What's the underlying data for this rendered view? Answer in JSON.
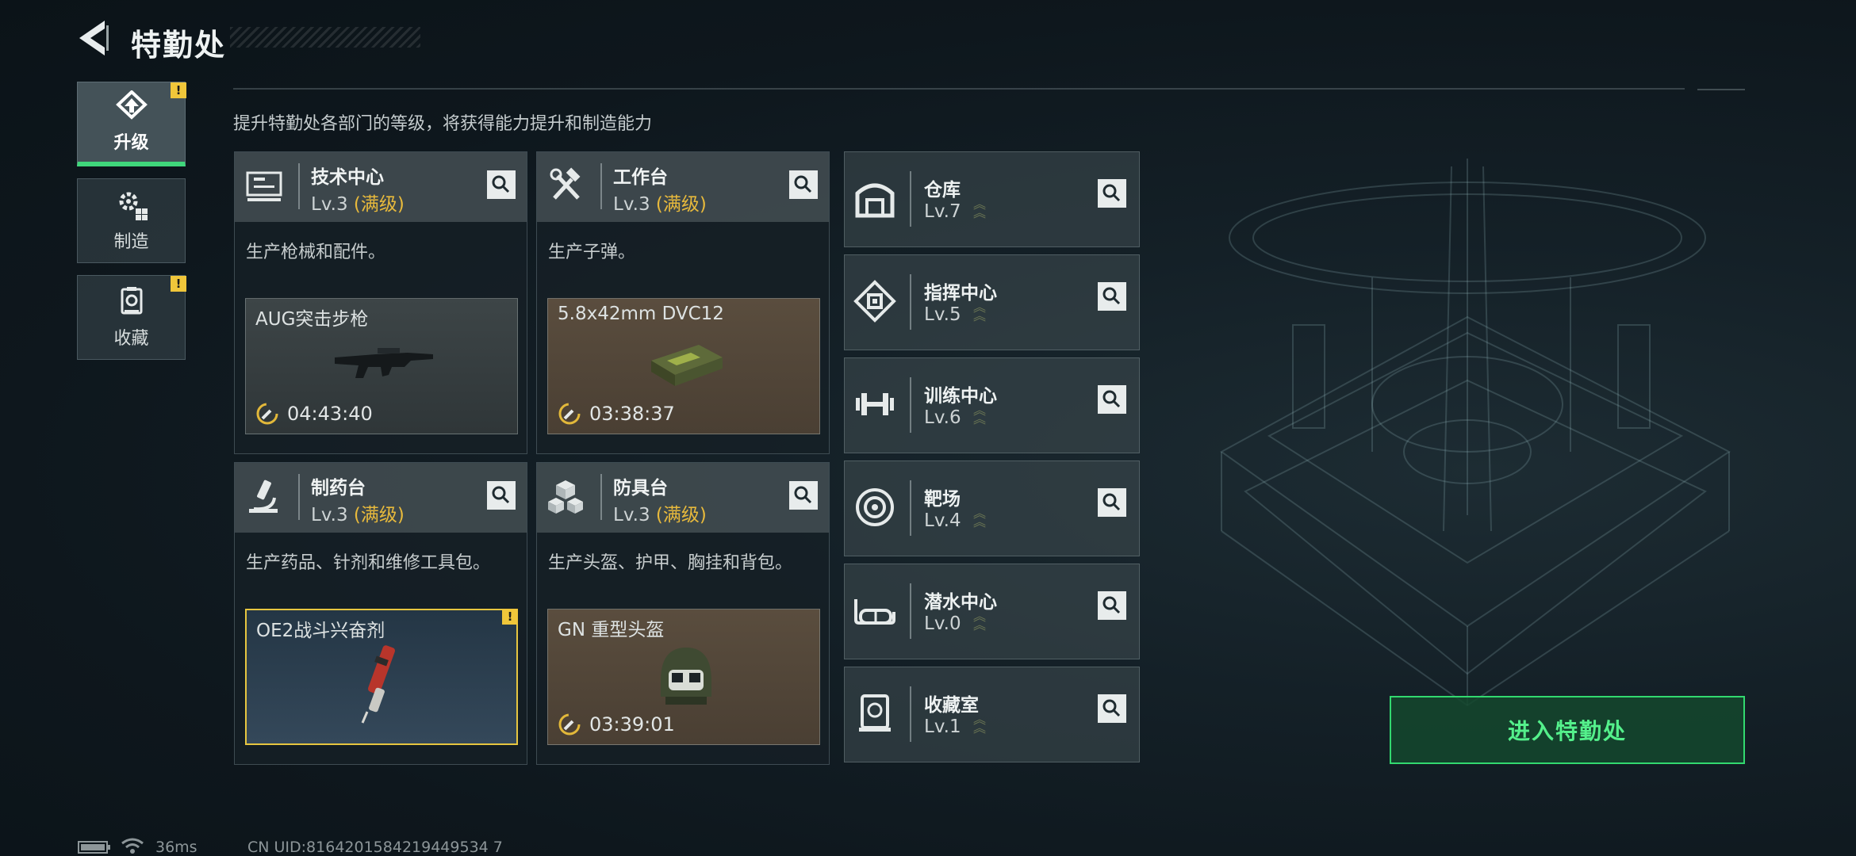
{
  "header": {
    "title": "特勤处",
    "subtitle": "提升特勤处各部门的等级，将获得能力提升和制造能力"
  },
  "tabs": [
    {
      "label": "升级",
      "icon": "upgrade-icon",
      "alert": "!"
    },
    {
      "label": "制造",
      "icon": "gear-icon"
    },
    {
      "label": "收藏",
      "icon": "collection-icon",
      "alert": "!"
    }
  ],
  "workshops": [
    {
      "name": "技术中心",
      "level": "Lv.3",
      "max": "(满级)",
      "desc": "生产枪械和配件。",
      "product": "AUG突击步枪",
      "timer": "04:43:40"
    },
    {
      "name": "工作台",
      "level": "Lv.3",
      "max": "(满级)",
      "desc": "生产子弹。",
      "product": "5.8x42mm DVC12",
      "timer": "03:38:37"
    },
    {
      "name": "制药台",
      "level": "Lv.3",
      "max": "(满级)",
      "desc": "生产药品、针剂和维修工具包。",
      "product": "OE2战斗兴奋剂",
      "alert": "!"
    },
    {
      "name": "防具台",
      "level": "Lv.3",
      "max": "(满级)",
      "desc": "生产头盔、护甲、胸挂和背包。",
      "product": "GN 重型头盔",
      "timer": "03:39:01"
    }
  ],
  "facilities": [
    {
      "name": "仓库",
      "level": "Lv.7",
      "icon": "warehouse-icon"
    },
    {
      "name": "指挥中心",
      "level": "Lv.5",
      "icon": "command-center-icon"
    },
    {
      "name": "训练中心",
      "level": "Lv.6",
      "icon": "dumbbell-icon"
    },
    {
      "name": "靶场",
      "level": "Lv.4",
      "icon": "target-icon"
    },
    {
      "name": "潜水中心",
      "level": "Lv.0",
      "icon": "diving-mask-icon"
    },
    {
      "name": "收藏室",
      "level": "Lv.1",
      "icon": "collection-room-icon"
    }
  ],
  "enter_button": "进入特勤处",
  "status_bar": {
    "ping": "36ms",
    "uid": "CN UID:8164201584219449534 7"
  },
  "colors": {
    "accent": "#32d96f",
    "max_level": "#e7b93c",
    "alert": "#f0c63a"
  }
}
